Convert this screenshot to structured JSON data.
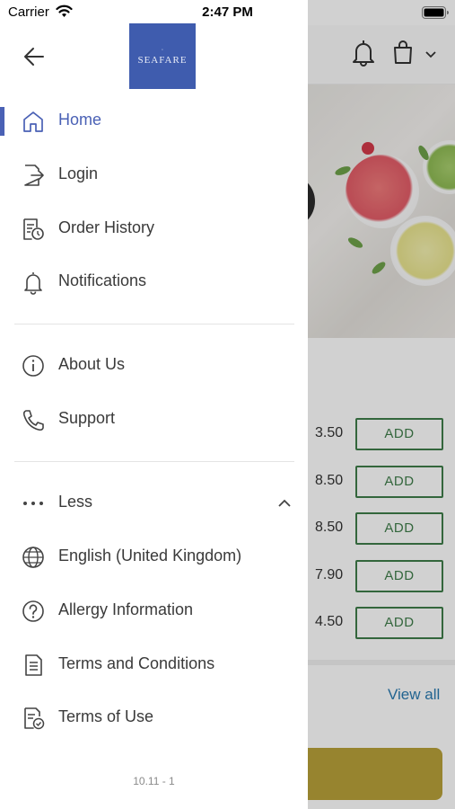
{
  "status_bar": {
    "carrier": "Carrier",
    "time": "2:47 PM"
  },
  "drawer": {
    "logo_text": "SEAFARE",
    "primary_items": [
      {
        "label": "Home",
        "icon": "home-icon",
        "active": true
      },
      {
        "label": "Login",
        "icon": "login-icon",
        "active": false
      },
      {
        "label": "Order History",
        "icon": "order-history-icon",
        "active": false
      },
      {
        "label": "Notifications",
        "icon": "bell-icon",
        "active": false
      }
    ],
    "secondary_items": [
      {
        "label": "About Us",
        "icon": "info-icon"
      },
      {
        "label": "Support",
        "icon": "phone-icon"
      }
    ],
    "less_label": "Less",
    "more_items": [
      {
        "label": "English (United Kingdom)",
        "icon": "globe-icon"
      },
      {
        "label": "Allergy Information",
        "icon": "question-icon"
      },
      {
        "label": "Terms and Conditions",
        "icon": "document-icon"
      },
      {
        "label": "Terms of Use",
        "icon": "document-check-icon"
      }
    ],
    "version": "10.11 - 1"
  },
  "background": {
    "products": [
      {
        "price": "3.50",
        "add_label": "ADD"
      },
      {
        "price": "8.50",
        "add_label": "ADD"
      },
      {
        "price": "8.50",
        "add_label": "ADD"
      },
      {
        "price": "7.90",
        "add_label": "ADD"
      },
      {
        "price": "4.50",
        "add_label": "ADD"
      }
    ],
    "view_all_label": "View all"
  },
  "colors": {
    "accent": "#4a61b5",
    "logo_background": "#3f5cae",
    "add_button": "#3f7d4a",
    "link": "#2a7ab0",
    "cta": "#b9a23a"
  }
}
